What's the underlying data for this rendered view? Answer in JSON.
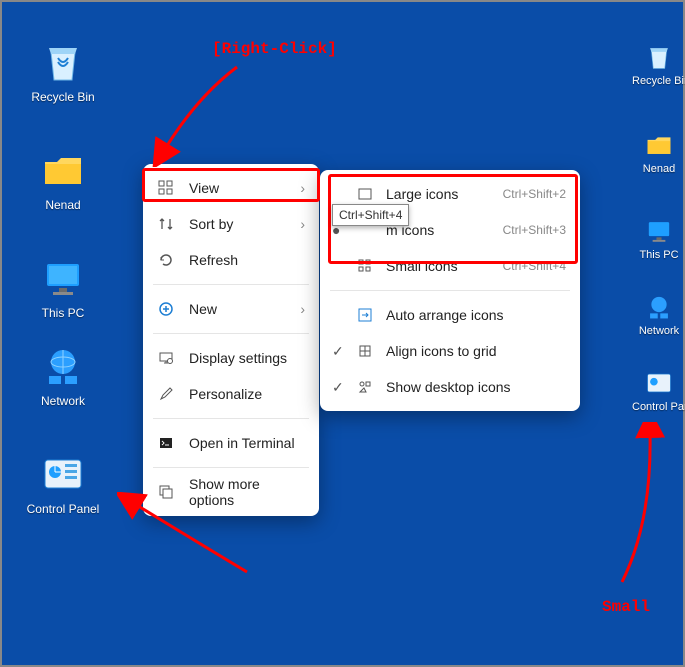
{
  "annotations": {
    "rightClick": "[Right-Click]",
    "small": "Small"
  },
  "tooltip": "Ctrl+Shift+4",
  "desktopLeft": {
    "recycle": "Recycle Bin",
    "nenad": "Nenad",
    "thispc": "This PC",
    "network": "Network",
    "cpanel": "Control Panel"
  },
  "desktopRight": {
    "recycle": "Recycle Bin",
    "nenad": "Nenad",
    "thispc": "This PC",
    "network": "Network",
    "cpanel": "Control Panel"
  },
  "menu1": {
    "view": "View",
    "sort": "Sort by",
    "refresh": "Refresh",
    "new": "New",
    "display": "Display settings",
    "personalize": "Personalize",
    "terminal": "Open in Terminal",
    "more": "Show more options"
  },
  "menu2": {
    "large": {
      "label": "Large icons",
      "sc": "Ctrl+Shift+2"
    },
    "medium": {
      "label": "m icons",
      "sc": "Ctrl+Shift+3"
    },
    "small": {
      "label": "Small icons",
      "sc": "Ctrl+Shift+4"
    },
    "auto": "Auto arrange icons",
    "align": "Align icons to grid",
    "show": "Show desktop icons"
  }
}
